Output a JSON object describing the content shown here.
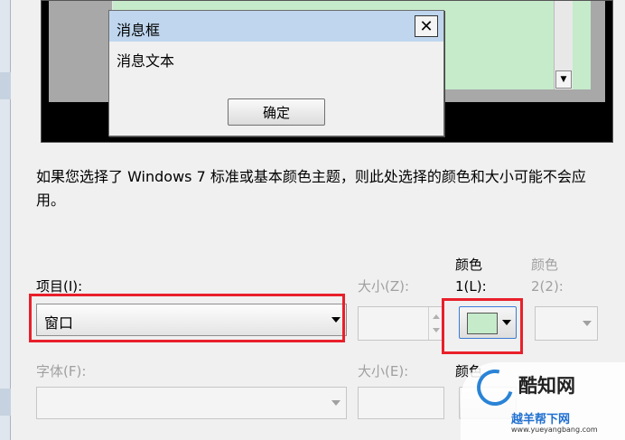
{
  "preview": {
    "msgbox_title": "消息框",
    "msgbox_close": "✕",
    "msgbox_text": "消息文本",
    "msgbox_ok": "确定"
  },
  "info_text": "如果您选择了 Windows 7 标准或基本颜色主题，则此处选择的颜色和大小可能不会应用。",
  "item": {
    "label": "项目(I):",
    "value": "窗口"
  },
  "size1": {
    "label": "大小(Z):"
  },
  "color1": {
    "label_line1": "颜色",
    "label_line2": "1(L):",
    "swatch": "#c6ebcb"
  },
  "color2": {
    "label_line1": "颜色",
    "label_line2": "2(2):"
  },
  "font": {
    "label": "字体(F):"
  },
  "size2": {
    "label": "大小(E):"
  },
  "font_color": {
    "label": "颜色"
  },
  "watermark": {
    "line1": "酷知网",
    "line2": "越羊帮下网",
    "line3": "www.yueyangbang.com"
  },
  "colors": {
    "highlight_red": "#e8202a",
    "msgbox_titlebar": "#bfd6ee",
    "preview_window": "#c6ebcb"
  }
}
